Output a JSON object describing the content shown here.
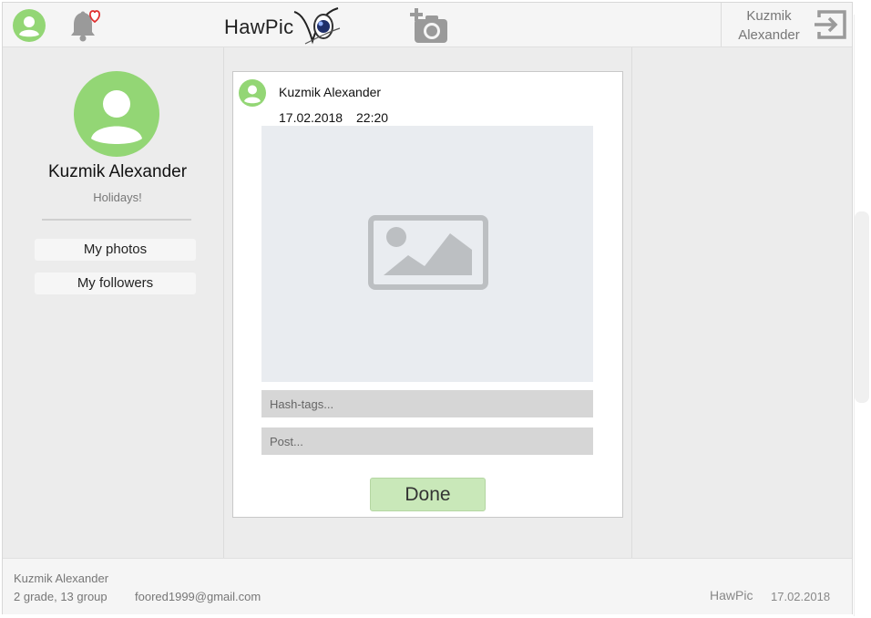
{
  "header": {
    "logo_text": "HawPic",
    "user_name_line1": "Kuzmik",
    "user_name_line2": "Alexander",
    "icons": {
      "avatar": "user-circle-icon",
      "notifications": "bell-heart-icon",
      "logo_mark": "logo-eye-icon",
      "add_photo": "camera-plus-icon",
      "logout": "sign-out-icon"
    }
  },
  "sidebar": {
    "name": "Kuzmik Alexander",
    "status": "Holidays!",
    "buttons": [
      {
        "label": "My photos"
      },
      {
        "label": "My followers"
      }
    ]
  },
  "post": {
    "author": "Kuzmik Alexander",
    "date": "17.02.2018",
    "time": "22:20",
    "image_icon": "image-placeholder-icon",
    "hashtags_placeholder": "Hash-tags...",
    "post_placeholder": "Post...",
    "done_label": "Done"
  },
  "footer": {
    "name": "Kuzmik Alexander",
    "grade": "2 grade, 13 group",
    "email": "foored1999@gmail.com",
    "brand": "HawPic",
    "date": "17.02.2018"
  },
  "colors": {
    "accent_green": "#93d675",
    "button_green": "#c9e8b9",
    "background": "#ececec",
    "header_bg": "#f5f5f5",
    "heart_red": "#e03030"
  }
}
